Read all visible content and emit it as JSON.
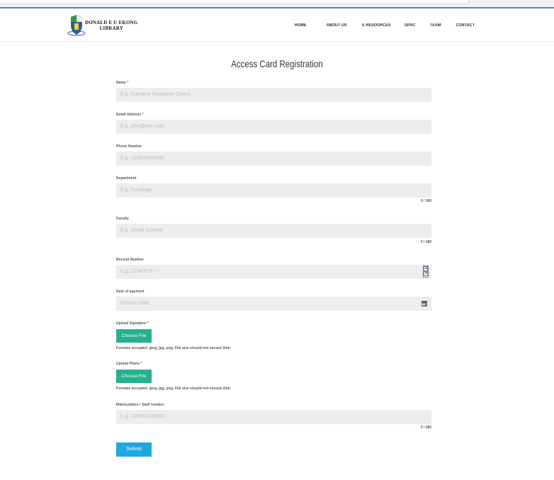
{
  "header": {
    "logo_line1": "DONALD E U EKONG",
    "logo_line2": "LIBRARY",
    "nav": {
      "home": "HOME",
      "about": "ABOUT US",
      "eresources": "E RESOURCES",
      "opac": "OPAC",
      "team": "TEAM",
      "contact": "CONTACT"
    }
  },
  "form": {
    "title": "Access Card Registration",
    "name": {
      "label": "Name",
      "required": "*",
      "placeholder": "E.g. Surname Firstname Others"
    },
    "email": {
      "label": "Email Address",
      "required": "*",
      "placeholder": "E.g. john@doe.com"
    },
    "phone": {
      "label": "Phone Number",
      "placeholder": "E.g. +13004005000"
    },
    "department": {
      "label": "Department",
      "placeholder": "E.g. Sociology",
      "counter": "0 / 180"
    },
    "faculty": {
      "label": "Faculty",
      "placeholder": "E.g. Social Science",
      "counter": "0 / 180"
    },
    "receipt": {
      "label": "Receipt Number",
      "placeholder": "E.g. 12345678"
    },
    "date": {
      "label": "Date of payment",
      "placeholder": "Choose Date"
    },
    "signature": {
      "label": "Upload Signature",
      "required": "*",
      "button": "Choose File",
      "hint": "Formats accepted: jpeg, jpg, png. File size should not exceed 2mb"
    },
    "photo": {
      "label": "Upload Photo",
      "required": "*",
      "button": "Choose File",
      "hint": "Formats accepted: jpeg, jpg, png. File size should not exceed 2mb"
    },
    "matric": {
      "label": "Matriculation / Staff number",
      "placeholder": "E.g. U2016/1234567",
      "counter": "0 / 180"
    },
    "submit": "Submit"
  },
  "colors": {
    "accent_green": "#26b08e",
    "submit_blue": "#1da8e3"
  }
}
